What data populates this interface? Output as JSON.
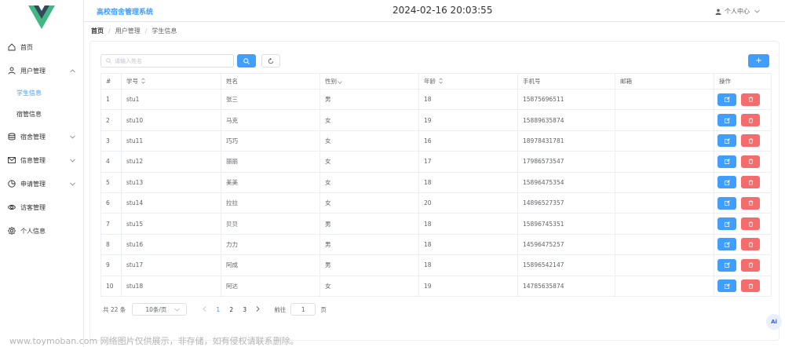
{
  "header": {
    "app_title": "高校宿舍管理系统",
    "datetime": "2024-02-16 20:03:55",
    "user_menu_label": "个人中心"
  },
  "sidebar": {
    "items": [
      {
        "label": "首页",
        "icon": "home-icon"
      },
      {
        "label": "用户管理",
        "icon": "user-icon",
        "expanded": true,
        "children": [
          {
            "label": "学生信息",
            "active": true
          },
          {
            "label": "宿管信息"
          }
        ]
      },
      {
        "label": "宿舍管理",
        "icon": "database-icon"
      },
      {
        "label": "信息管理",
        "icon": "message-icon"
      },
      {
        "label": "申请管理",
        "icon": "pie-chart-icon"
      },
      {
        "label": "访客管理",
        "icon": "eye-icon"
      },
      {
        "label": "个人信息",
        "icon": "settings-icon"
      }
    ]
  },
  "breadcrumb": [
    "首页",
    "用户管理",
    "学生信息"
  ],
  "toolbar": {
    "search_placeholder": "请输入姓名",
    "add_label": "+"
  },
  "table": {
    "columns": [
      "#",
      "学号",
      "姓名",
      "性别",
      "年龄",
      "手机号",
      "邮箱",
      "操作"
    ],
    "rows": [
      [
        "1",
        "stu1",
        "张三",
        "男",
        "18",
        "15875696511",
        ""
      ],
      [
        "2",
        "stu10",
        "马克",
        "女",
        "19",
        "15889635874",
        ""
      ],
      [
        "3",
        "stu11",
        "巧巧",
        "女",
        "16",
        "18978431781",
        ""
      ],
      [
        "4",
        "stu12",
        "丽丽",
        "女",
        "17",
        "17986573547",
        ""
      ],
      [
        "5",
        "stu13",
        "美美",
        "女",
        "18",
        "15896475354",
        ""
      ],
      [
        "6",
        "stu14",
        "拉拉",
        "女",
        "20",
        "14896527357",
        ""
      ],
      [
        "7",
        "stu15",
        "贝贝",
        "男",
        "18",
        "15896745351",
        ""
      ],
      [
        "8",
        "stu16",
        "力力",
        "男",
        "18",
        "14596475257",
        ""
      ],
      [
        "9",
        "stu17",
        "阿成",
        "男",
        "18",
        "15896542147",
        ""
      ],
      [
        "10",
        "stu18",
        "阿达",
        "女",
        "19",
        "14785635874",
        ""
      ]
    ]
  },
  "pagination": {
    "total_text": "共 22 条",
    "page_size": "10条/页",
    "pages": [
      "1",
      "2",
      "3"
    ],
    "current": "1",
    "goto_label": "前往",
    "goto_value": "1",
    "page_suffix": "页"
  },
  "ai_badge": "Ai",
  "watermark": "www.toymoban.com 网络图片仅供展示，非存储，如有侵权请联系删除。",
  "colors": {
    "primary": "#409eff",
    "danger": "#f56c6c",
    "logo_green": "#41b883",
    "logo_dark": "#35495e"
  }
}
